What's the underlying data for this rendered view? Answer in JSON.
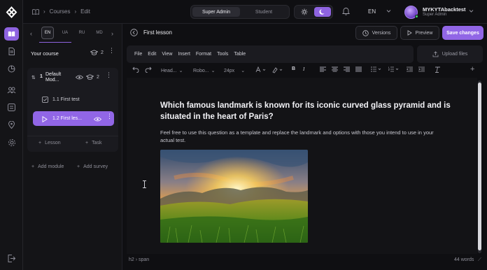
{
  "app": {
    "breadcrumb": [
      "Courses",
      "Edit"
    ],
    "roles": [
      "Super Admin",
      "Student"
    ],
    "selected_role": "Super Admin",
    "language": "EN",
    "user": {
      "name": "MYKYTAbacktest",
      "role": "Super Admin"
    }
  },
  "sidebar": {
    "lang_tabs": [
      "EN",
      "UA",
      "RU",
      "MD"
    ],
    "selected_lang": "EN",
    "course_label": "Your course",
    "course_count": "2",
    "module": {
      "title": "Default Mod...",
      "count": "2",
      "index": "1"
    },
    "lessons": [
      {
        "label": "1.1 First test"
      },
      {
        "label": "1.2 First les..."
      }
    ],
    "add_lesson": "Lesson",
    "add_task": "Task",
    "add_module": "Add module",
    "add_survey": "Add survey"
  },
  "main": {
    "lesson_title": "First lesson",
    "versions_label": "Versions",
    "preview_label": "Preview",
    "save_label": "Save changes",
    "menu": [
      "File",
      "Edit",
      "View",
      "Insert",
      "Format",
      "Tools",
      "Table"
    ],
    "upload_label": "Upload files",
    "toolbar": {
      "heading": "Head...",
      "font": "Robo...",
      "size": "24px"
    },
    "question": "Which famous landmark is known for its iconic curved glass pyramid and is situated in the heart of Paris?",
    "description": "Feel free to use this question as a template and replace the landmark and options with those you intend to use in your actual test.",
    "status_path": "h2 › span",
    "word_count": "44 words"
  },
  "colors": {
    "accent": "#9166e6",
    "background": "#0f0f12",
    "panel": "#141417"
  }
}
